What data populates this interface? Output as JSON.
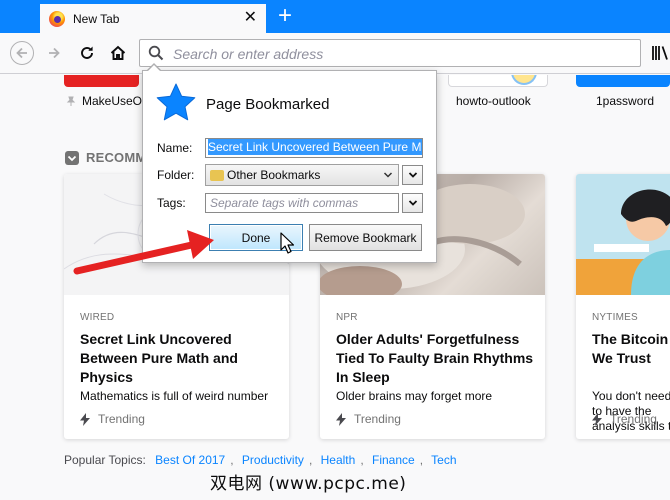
{
  "browser": {
    "tab_title": "New Tab",
    "address_placeholder": "Search or enter address"
  },
  "topsites": [
    "MakeUseOf",
    "howto-outlook",
    "1password"
  ],
  "section_title": "RECOMMENDED BY POCKET",
  "cards": [
    {
      "source": "WIRED",
      "headline": "Secret Link Uncovered Between Pure Math and Physics",
      "desc": "Mathematics is full of weird number",
      "trend": "Trending"
    },
    {
      "source": "NPR",
      "headline": "Older Adults' Forgetfulness Tied To Faulty Brain Rhythms In Sleep",
      "desc": "Older brains may forget more",
      "trend": "Trending"
    },
    {
      "source": "NYTIMES",
      "headline": "The Bitcoin Boom: In Code We Trust",
      "desc": "You don't need to have the analysis skills to",
      "trend": "Trending"
    }
  ],
  "popular": {
    "label": "Popular Topics:",
    "topics": [
      "Best Of 2017",
      "Productivity",
      "Health",
      "Finance",
      "Tech"
    ]
  },
  "panel": {
    "title": "Page Bookmarked",
    "name_label": "Name:",
    "name_value": "Secret Link Uncovered Between Pure Ma",
    "folder_label": "Folder:",
    "folder_value": "Other Bookmarks",
    "tags_label": "Tags:",
    "tags_placeholder": "Separate tags with commas",
    "done_label": "Done",
    "remove_label": "Remove Bookmark"
  },
  "watermark": "双电网 (www.pcpc.me)",
  "colors": {
    "accent": "#0a84ff",
    "arrow": "#e52222",
    "star": "#0a84ff"
  }
}
